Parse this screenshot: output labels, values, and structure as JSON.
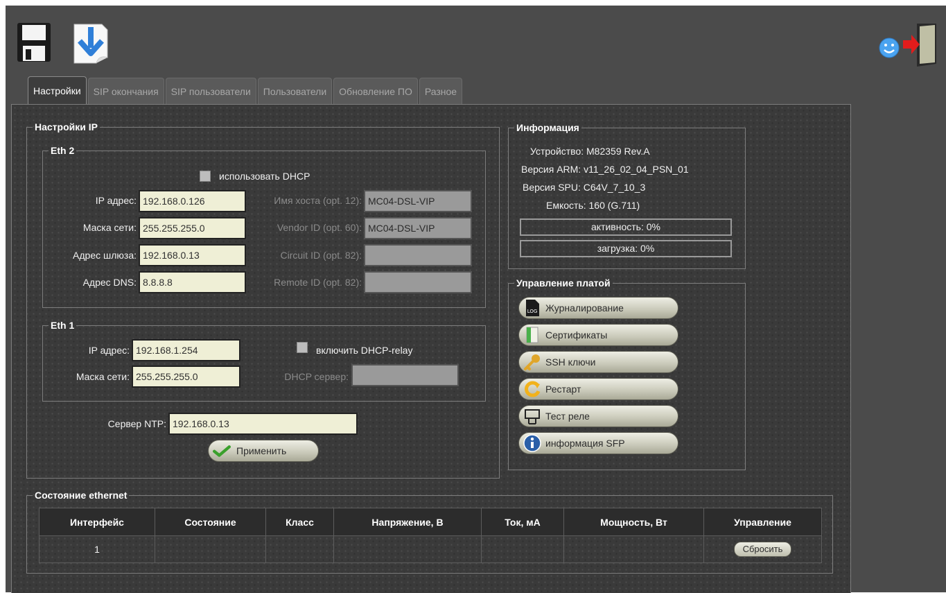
{
  "toolbar": {
    "save_icon": "floppy-disk-icon",
    "download_icon": "download-arrow-icon",
    "status_icon": "smiley-face-icon",
    "logout_icon": "exit-door-icon"
  },
  "tabs": [
    {
      "label": "Настройки",
      "active": true
    },
    {
      "label": "SIP окончания",
      "active": false
    },
    {
      "label": "SIP пользователи",
      "active": false
    },
    {
      "label": "Пользователи",
      "active": false
    },
    {
      "label": "Обновление ПО",
      "active": false
    },
    {
      "label": "Разное",
      "active": false
    }
  ],
  "ip_settings": {
    "legend": "Настройки IP",
    "eth2": {
      "legend": "Eth 2",
      "dhcp_label": "использовать DHCP",
      "dhcp_checked": false,
      "ip_label": "IP адрес:",
      "ip_value": "192.168.0.126",
      "mask_label": "Маска сети:",
      "mask_value": "255.255.255.0",
      "gateway_label": "Адрес шлюза:",
      "gateway_value": "192.168.0.13",
      "dns_label": "Адрес DNS:",
      "dns_value": "8.8.8.8",
      "hostname_label": "Имя хоста (opt. 12):",
      "hostname_value": "MC04-DSL-VIP",
      "vendor_label": "Vendor ID (opt. 60):",
      "vendor_value": "MC04-DSL-VIP",
      "circuit_label": "Circuit ID (opt. 82):",
      "circuit_value": "",
      "remote_label": "Remote ID (opt. 82):",
      "remote_value": ""
    },
    "eth1": {
      "legend": "Eth 1",
      "ip_label": "IP адрес:",
      "ip_value": "192.168.1.254",
      "mask_label": "Маска сети:",
      "mask_value": "255.255.255.0",
      "relay_label": "включить DHCP-relay",
      "relay_checked": false,
      "dhcp_server_label": "DHCP сервер:",
      "dhcp_server_value": ""
    },
    "ntp_label": "Сервер NTP:",
    "ntp_value": "192.168.0.13",
    "apply_label": "Применить"
  },
  "info": {
    "legend": "Информация",
    "device": "Устройство: M82359 Rev.A",
    "arm": "Версия ARM: v11_26_02_04_PSN_01",
    "spu": "Версия SPU: C64V_7_10_3",
    "capacity": "Емкость: 160 (G.711)",
    "activity": "активность: 0%",
    "load": "загрузка: 0%",
    "activity_percent": 0,
    "load_percent": 0
  },
  "board": {
    "legend": "Управление платой",
    "buttons": [
      {
        "label": "Журналирование",
        "icon": "log-file-icon"
      },
      {
        "label": "Сертификаты",
        "icon": "certificate-icon"
      },
      {
        "label": "SSH ключи",
        "icon": "key-icon"
      },
      {
        "label": "Рестарт",
        "icon": "restart-icon"
      },
      {
        "label": "Тест реле",
        "icon": "relay-icon"
      },
      {
        "label": "информация SFP",
        "icon": "info-icon"
      }
    ]
  },
  "ethernet": {
    "legend": "Состояние ethernet",
    "columns": [
      "Интерфейс",
      "Состояние",
      "Класс",
      "Напряжение, В",
      "Ток, мА",
      "Мощность, Вт",
      "Управление"
    ],
    "rows": [
      {
        "interface": "1",
        "state": "",
        "class": "",
        "voltage": "",
        "current": "",
        "power": "",
        "action": "Сбросить"
      }
    ]
  }
}
